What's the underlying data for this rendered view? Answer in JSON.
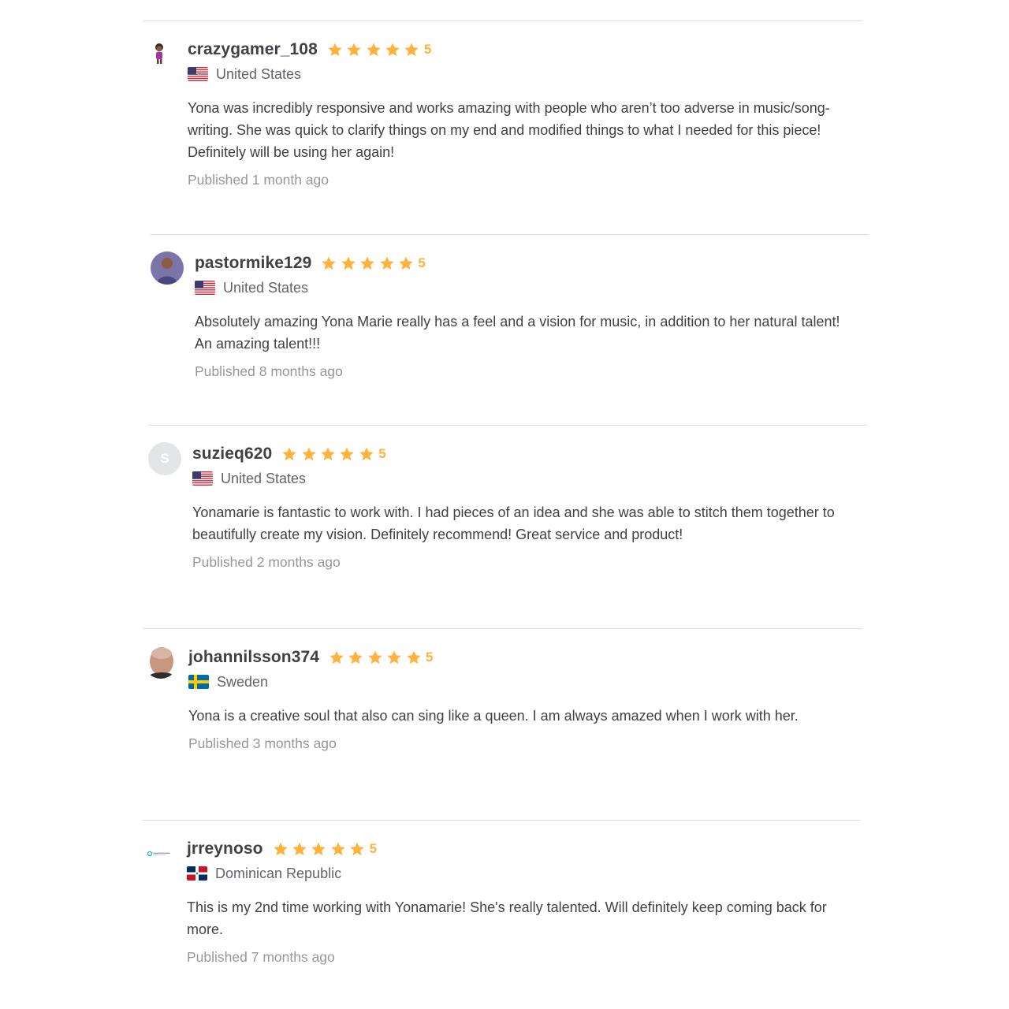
{
  "reviews": [
    {
      "username": "crazygamer_108",
      "rating": "5",
      "country": "United States",
      "flag": "us-flag",
      "avatar": "cartoon-avatar",
      "text": "Yona was incredibly responsive and works amazing with people who aren’t too adverse in music/song-writing. She was quick to clarify things on my end and modified things to what I needed for this piece! Definitely will be using her again!",
      "published": "Published 1 month ago"
    },
    {
      "username": "pastormike129",
      "rating": "5",
      "country": "United States",
      "flag": "us-flag",
      "avatar": "photo-avatar",
      "text": "Absolutely amazing Yona Marie really has a feel and a vision for music, in addition to her natural talent! An amazing talent!!!",
      "published": "Published 8 months ago"
    },
    {
      "username": "suzieq620",
      "rating": "5",
      "country": "United States",
      "flag": "us-flag",
      "avatar_letter": "S",
      "text": "Yonamarie is fantastic to work with. I had pieces of an idea and she was able to stitch them together to beautifully create my vision. Definitely recommend! Great service and product!",
      "published": "Published 2 months ago"
    },
    {
      "username": "johannilsson374",
      "rating": "5",
      "country": "Sweden",
      "flag": "sweden-flag",
      "avatar": "photo-avatar",
      "text": "Yona is a creative soul that also can sing like a queen. I am always amazed when I work with her.",
      "published": "Published 3 months ago"
    },
    {
      "username": "jrreynoso",
      "rating": "5",
      "country": "Dominican Republic",
      "flag": "dominican-republic-flag",
      "avatar": "logo-avatar",
      "text": "This is my 2nd time working with Yonamarie! She's really talented. Will definitely keep coming back for more.",
      "published": "Published 7 months ago"
    }
  ],
  "colors": {
    "star": "#ffb33e",
    "divider": "#dadbdd",
    "muted_text": "#95979d"
  }
}
